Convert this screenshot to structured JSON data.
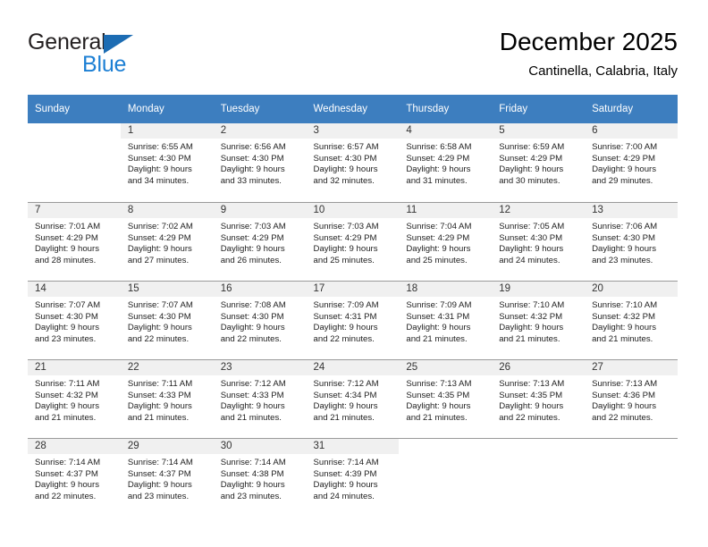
{
  "brand": {
    "name_part1": "General",
    "name_part2": "Blue",
    "accent_color": "#1c7fd4",
    "triangle_color": "#1c6cb3"
  },
  "header": {
    "title": "December 2025",
    "subtitle": "Cantinella, Calabria, Italy"
  },
  "calendar": {
    "header_bg": "#3d7ebf",
    "daynum_bg": "#f0f0f0",
    "weekday_headers": [
      "Sunday",
      "Monday",
      "Tuesday",
      "Wednesday",
      "Thursday",
      "Friday",
      "Saturday"
    ],
    "weeks": [
      [
        {
          "day": "",
          "lines": []
        },
        {
          "day": "1",
          "lines": [
            "Sunrise: 6:55 AM",
            "Sunset: 4:30 PM",
            "Daylight: 9 hours",
            "and 34 minutes."
          ]
        },
        {
          "day": "2",
          "lines": [
            "Sunrise: 6:56 AM",
            "Sunset: 4:30 PM",
            "Daylight: 9 hours",
            "and 33 minutes."
          ]
        },
        {
          "day": "3",
          "lines": [
            "Sunrise: 6:57 AM",
            "Sunset: 4:30 PM",
            "Daylight: 9 hours",
            "and 32 minutes."
          ]
        },
        {
          "day": "4",
          "lines": [
            "Sunrise: 6:58 AM",
            "Sunset: 4:29 PM",
            "Daylight: 9 hours",
            "and 31 minutes."
          ]
        },
        {
          "day": "5",
          "lines": [
            "Sunrise: 6:59 AM",
            "Sunset: 4:29 PM",
            "Daylight: 9 hours",
            "and 30 minutes."
          ]
        },
        {
          "day": "6",
          "lines": [
            "Sunrise: 7:00 AM",
            "Sunset: 4:29 PM",
            "Daylight: 9 hours",
            "and 29 minutes."
          ]
        }
      ],
      [
        {
          "day": "7",
          "lines": [
            "Sunrise: 7:01 AM",
            "Sunset: 4:29 PM",
            "Daylight: 9 hours",
            "and 28 minutes."
          ]
        },
        {
          "day": "8",
          "lines": [
            "Sunrise: 7:02 AM",
            "Sunset: 4:29 PM",
            "Daylight: 9 hours",
            "and 27 minutes."
          ]
        },
        {
          "day": "9",
          "lines": [
            "Sunrise: 7:03 AM",
            "Sunset: 4:29 PM",
            "Daylight: 9 hours",
            "and 26 minutes."
          ]
        },
        {
          "day": "10",
          "lines": [
            "Sunrise: 7:03 AM",
            "Sunset: 4:29 PM",
            "Daylight: 9 hours",
            "and 25 minutes."
          ]
        },
        {
          "day": "11",
          "lines": [
            "Sunrise: 7:04 AM",
            "Sunset: 4:29 PM",
            "Daylight: 9 hours",
            "and 25 minutes."
          ]
        },
        {
          "day": "12",
          "lines": [
            "Sunrise: 7:05 AM",
            "Sunset: 4:30 PM",
            "Daylight: 9 hours",
            "and 24 minutes."
          ]
        },
        {
          "day": "13",
          "lines": [
            "Sunrise: 7:06 AM",
            "Sunset: 4:30 PM",
            "Daylight: 9 hours",
            "and 23 minutes."
          ]
        }
      ],
      [
        {
          "day": "14",
          "lines": [
            "Sunrise: 7:07 AM",
            "Sunset: 4:30 PM",
            "Daylight: 9 hours",
            "and 23 minutes."
          ]
        },
        {
          "day": "15",
          "lines": [
            "Sunrise: 7:07 AM",
            "Sunset: 4:30 PM",
            "Daylight: 9 hours",
            "and 22 minutes."
          ]
        },
        {
          "day": "16",
          "lines": [
            "Sunrise: 7:08 AM",
            "Sunset: 4:30 PM",
            "Daylight: 9 hours",
            "and 22 minutes."
          ]
        },
        {
          "day": "17",
          "lines": [
            "Sunrise: 7:09 AM",
            "Sunset: 4:31 PM",
            "Daylight: 9 hours",
            "and 22 minutes."
          ]
        },
        {
          "day": "18",
          "lines": [
            "Sunrise: 7:09 AM",
            "Sunset: 4:31 PM",
            "Daylight: 9 hours",
            "and 21 minutes."
          ]
        },
        {
          "day": "19",
          "lines": [
            "Sunrise: 7:10 AM",
            "Sunset: 4:32 PM",
            "Daylight: 9 hours",
            "and 21 minutes."
          ]
        },
        {
          "day": "20",
          "lines": [
            "Sunrise: 7:10 AM",
            "Sunset: 4:32 PM",
            "Daylight: 9 hours",
            "and 21 minutes."
          ]
        }
      ],
      [
        {
          "day": "21",
          "lines": [
            "Sunrise: 7:11 AM",
            "Sunset: 4:32 PM",
            "Daylight: 9 hours",
            "and 21 minutes."
          ]
        },
        {
          "day": "22",
          "lines": [
            "Sunrise: 7:11 AM",
            "Sunset: 4:33 PM",
            "Daylight: 9 hours",
            "and 21 minutes."
          ]
        },
        {
          "day": "23",
          "lines": [
            "Sunrise: 7:12 AM",
            "Sunset: 4:33 PM",
            "Daylight: 9 hours",
            "and 21 minutes."
          ]
        },
        {
          "day": "24",
          "lines": [
            "Sunrise: 7:12 AM",
            "Sunset: 4:34 PM",
            "Daylight: 9 hours",
            "and 21 minutes."
          ]
        },
        {
          "day": "25",
          "lines": [
            "Sunrise: 7:13 AM",
            "Sunset: 4:35 PM",
            "Daylight: 9 hours",
            "and 21 minutes."
          ]
        },
        {
          "day": "26",
          "lines": [
            "Sunrise: 7:13 AM",
            "Sunset: 4:35 PM",
            "Daylight: 9 hours",
            "and 22 minutes."
          ]
        },
        {
          "day": "27",
          "lines": [
            "Sunrise: 7:13 AM",
            "Sunset: 4:36 PM",
            "Daylight: 9 hours",
            "and 22 minutes."
          ]
        }
      ],
      [
        {
          "day": "28",
          "lines": [
            "Sunrise: 7:14 AM",
            "Sunset: 4:37 PM",
            "Daylight: 9 hours",
            "and 22 minutes."
          ]
        },
        {
          "day": "29",
          "lines": [
            "Sunrise: 7:14 AM",
            "Sunset: 4:37 PM",
            "Daylight: 9 hours",
            "and 23 minutes."
          ]
        },
        {
          "day": "30",
          "lines": [
            "Sunrise: 7:14 AM",
            "Sunset: 4:38 PM",
            "Daylight: 9 hours",
            "and 23 minutes."
          ]
        },
        {
          "day": "31",
          "lines": [
            "Sunrise: 7:14 AM",
            "Sunset: 4:39 PM",
            "Daylight: 9 hours",
            "and 24 minutes."
          ]
        },
        {
          "day": "",
          "lines": []
        },
        {
          "day": "",
          "lines": []
        },
        {
          "day": "",
          "lines": []
        }
      ]
    ]
  }
}
